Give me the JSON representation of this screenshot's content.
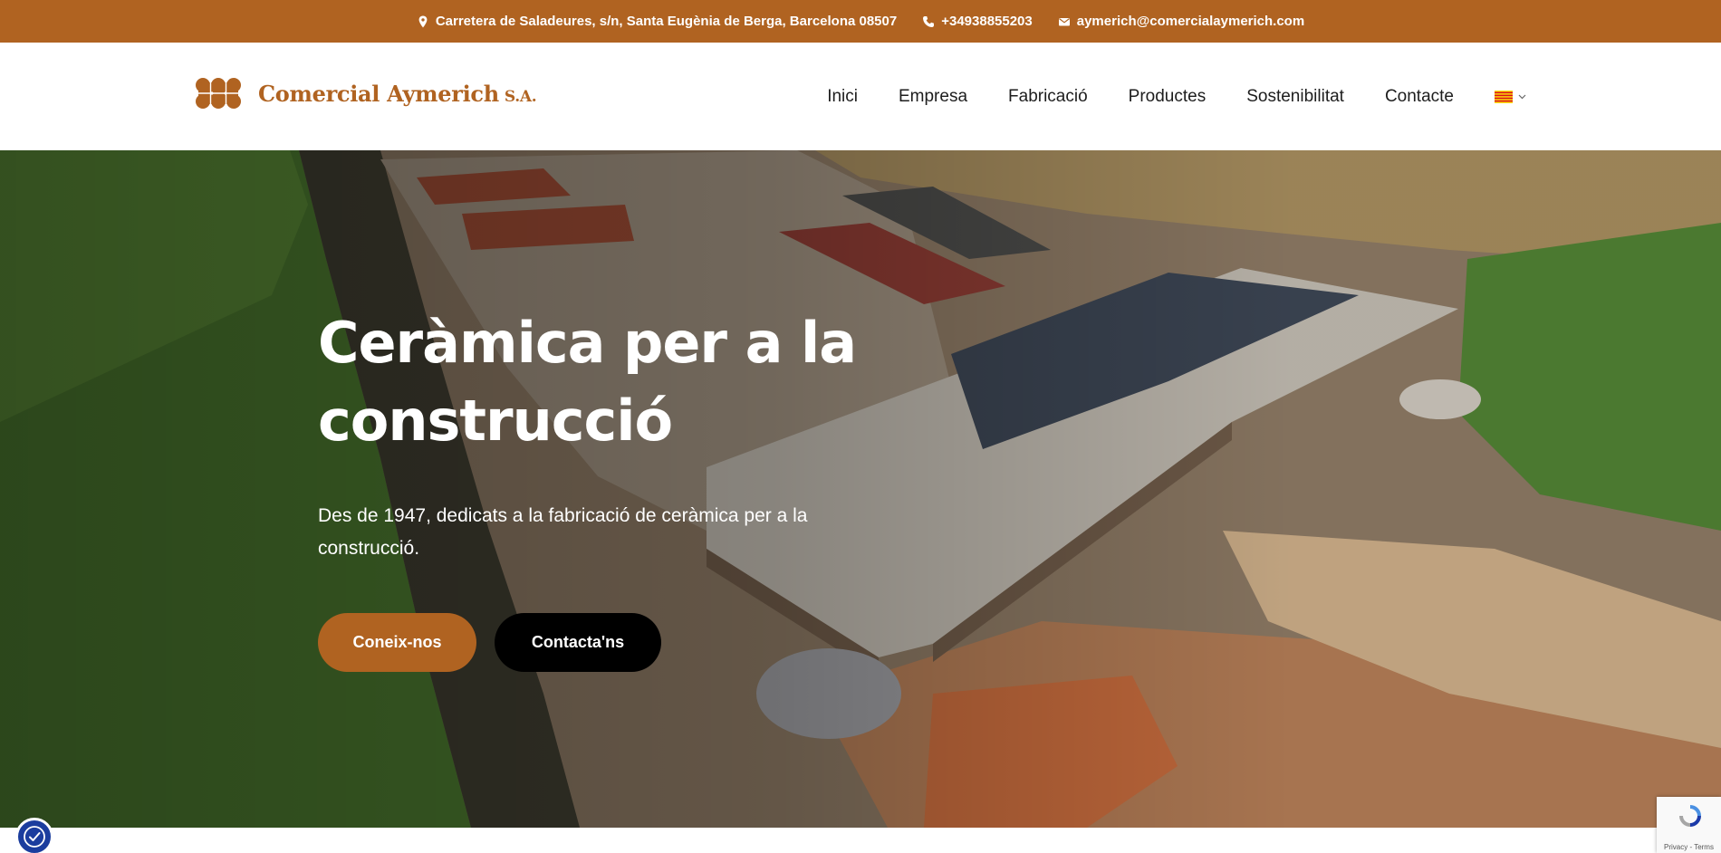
{
  "topbar": {
    "address": "Carretera de Saladeures, s/n, Santa Eugènia de Berga, Barcelona 08507",
    "phone": "+34938855203",
    "email": "aymerich@comercialaymerich.com"
  },
  "header": {
    "logo_name": "Comercial Aymerich",
    "logo_suffix": "S.A.",
    "nav": [
      "Inici",
      "Empresa",
      "Fabricació",
      "Productes",
      "Sostenibilitat",
      "Contacte"
    ],
    "language": "catalan-flag-icon"
  },
  "hero": {
    "title_line1": "Ceràmica per a la",
    "title_line2": "construcció",
    "subtitle": "Des de 1947, dedicats a la fabricació de ceràmica per a la construcció.",
    "buttons": {
      "primary": "Coneix-nos",
      "secondary": "Contacta'ns"
    }
  },
  "recaptcha": {
    "links": "Privacy - Terms"
  },
  "colors": {
    "brand": "#b06321",
    "dark": "#000000",
    "accessibility": "#1b3d9e"
  }
}
